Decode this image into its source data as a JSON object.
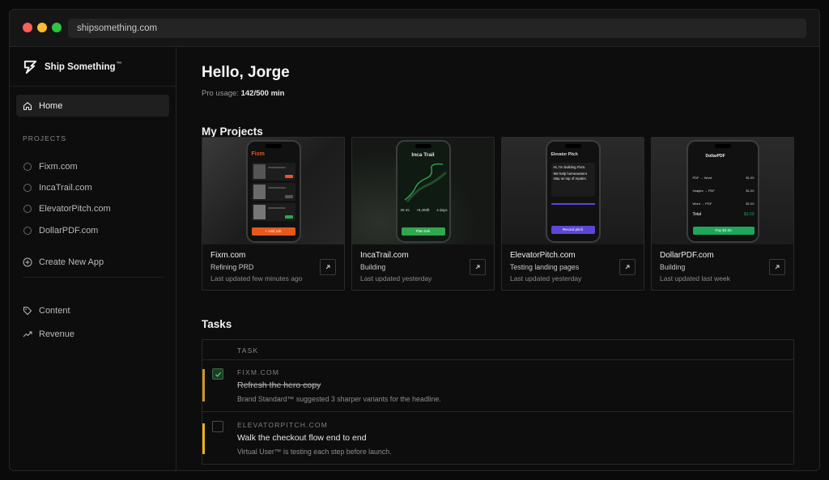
{
  "browser": {
    "url": "shipsomething.com"
  },
  "colors": {
    "red": "#ff5f57",
    "yellow": "#febc2e",
    "green": "#28c840",
    "accent_gold": "#c99a1f",
    "accent_yellow": "#e7b416",
    "fixm_orange": "#e8581c",
    "inca_green": "#2fa84f",
    "pitch_purple": "#5b47d6",
    "pdf_green": "#1ea65a"
  },
  "sidebar": {
    "brand": "Ship Something",
    "brand_tm": "™",
    "home": "Home",
    "projects_label": "PROJECTS",
    "projects": [
      {
        "label": "Fixm.com"
      },
      {
        "label": "IncaTrail.com"
      },
      {
        "label": "ElevatorPitch.com"
      },
      {
        "label": "DollarPDF.com"
      }
    ],
    "create_label": "Create New App",
    "content_label": "Content",
    "revenue_label": "Revenue"
  },
  "main": {
    "greeting": "Hello, Jorge",
    "usage_label": "Pro usage:",
    "usage_value": "142/500 min",
    "projects_heading": "My Projects",
    "tasks_heading": "Tasks"
  },
  "cards": [
    {
      "title": "Fixm.com",
      "status": "Refining PRD",
      "updated": "Last updated few minutes ago",
      "screen": {
        "app": "Fixm",
        "button": "+ Add Job"
      }
    },
    {
      "title": "IncaTrail.com",
      "status": "Building",
      "updated": "Last updated yesterday",
      "screen": {
        "app": "Inca Trail",
        "stats": [
          "25 mi",
          "+8,400ft",
          "4 days"
        ],
        "button": "Plan trek"
      }
    },
    {
      "title": "ElevatorPitch.com",
      "status": "Testing landing pages",
      "updated": "Last updated yesterday",
      "screen": {
        "app": "Elevator Pitch",
        "line1": "Hi, I'm building Fixm.",
        "line2": "We help homeowners stay on top of repairs.",
        "button": "Record pitch"
      }
    },
    {
      "title": "DollarPDF.com",
      "status": "Building",
      "updated": "Last updated last week",
      "screen": {
        "app": "DollarPDF",
        "items": [
          {
            "label": "PDF → Word",
            "price": "$1.00"
          },
          {
            "label": "Images → PDF",
            "price": "$1.00"
          },
          {
            "label": "Word → PDF",
            "price": "$1.00"
          }
        ],
        "total_label": "Total",
        "total": "$3.00",
        "button": "Pay $3.00"
      }
    }
  ],
  "tasks": {
    "column": "TASK",
    "rows": [
      {
        "project": "FIXM.COM",
        "title": "Refresh the hero copy",
        "desc": "Brand Standard™ suggested 3 sharper variants for the headline.",
        "done": true
      },
      {
        "project": "ELEVATORPITCH.COM",
        "title": "Walk the checkout flow end to end",
        "desc": "Virtual User™ is testing each step before launch.",
        "done": false
      }
    ]
  }
}
